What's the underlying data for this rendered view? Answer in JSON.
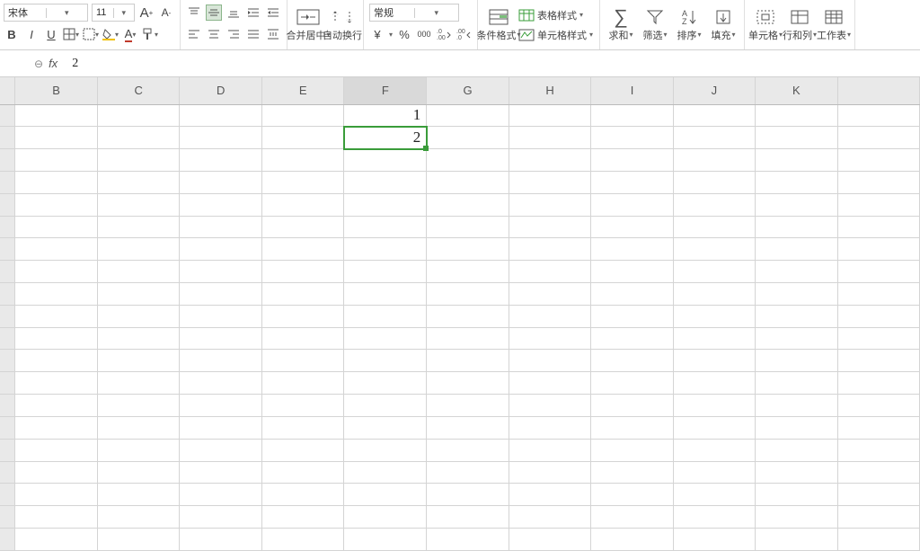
{
  "toolbar": {
    "font_name": "宋体",
    "font_size": "11",
    "number_format": "常规",
    "inc_font": "A",
    "dec_font": "A",
    "bold": "B",
    "italic": "I",
    "underline": "U",
    "merge_center": "合并居中",
    "wrap_text": "自动换行",
    "currency": "¥",
    "percent": "%",
    "thousands": "000",
    "inc_dec": ".0",
    "dec_dec": ".00",
    "cond_fmt": "条件格式",
    "table_style": "表格样式",
    "cell_style": "单元格样式",
    "sum": "求和",
    "filter": "筛选",
    "sort": "排序",
    "fill": "填充",
    "cell": "单元格",
    "row_col": "行和列",
    "worksheet": "工作表"
  },
  "formula_bar": {
    "fx": "fx",
    "value": "2"
  },
  "columns": [
    "B",
    "C",
    "D",
    "E",
    "F",
    "G",
    "H",
    "I",
    "J",
    "K"
  ],
  "cells": {
    "F1": "1",
    "F2": "2"
  },
  "grid": {
    "rows": 20
  }
}
